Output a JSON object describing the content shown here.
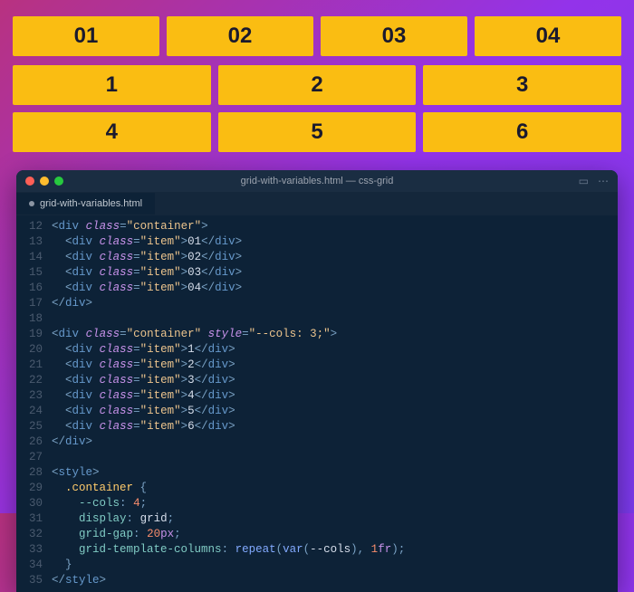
{
  "demo": {
    "row1": [
      "01",
      "02",
      "03",
      "04"
    ],
    "row2": [
      "1",
      "2",
      "3",
      "4",
      "5",
      "6"
    ]
  },
  "window": {
    "title": "grid-with-variables.html — css-grid",
    "tab": "grid-with-variables.html",
    "icon_split": "▭",
    "icon_more": "⋯"
  },
  "code": {
    "lines": [
      {
        "n": "12",
        "seg": [
          {
            "c": "p",
            "t": "<"
          },
          {
            "c": "t",
            "t": "div"
          },
          {
            "c": "p",
            "t": " "
          },
          {
            "c": "a",
            "t": "class"
          },
          {
            "c": "p",
            "t": "="
          },
          {
            "c": "s",
            "t": "\"container\""
          },
          {
            "c": "p",
            "t": ">"
          }
        ]
      },
      {
        "n": "13",
        "seg": [
          {
            "c": "p",
            "t": "  <"
          },
          {
            "c": "t",
            "t": "div"
          },
          {
            "c": "p",
            "t": " "
          },
          {
            "c": "a",
            "t": "class"
          },
          {
            "c": "p",
            "t": "="
          },
          {
            "c": "s",
            "t": "\"item\""
          },
          {
            "c": "p",
            "t": ">"
          },
          {
            "c": "txt",
            "t": "01"
          },
          {
            "c": "p",
            "t": "</"
          },
          {
            "c": "t",
            "t": "div"
          },
          {
            "c": "p",
            "t": ">"
          }
        ]
      },
      {
        "n": "14",
        "seg": [
          {
            "c": "p",
            "t": "  <"
          },
          {
            "c": "t",
            "t": "div"
          },
          {
            "c": "p",
            "t": " "
          },
          {
            "c": "a",
            "t": "class"
          },
          {
            "c": "p",
            "t": "="
          },
          {
            "c": "s",
            "t": "\"item\""
          },
          {
            "c": "p",
            "t": ">"
          },
          {
            "c": "txt",
            "t": "02"
          },
          {
            "c": "p",
            "t": "</"
          },
          {
            "c": "t",
            "t": "div"
          },
          {
            "c": "p",
            "t": ">"
          }
        ]
      },
      {
        "n": "15",
        "seg": [
          {
            "c": "p",
            "t": "  <"
          },
          {
            "c": "t",
            "t": "div"
          },
          {
            "c": "p",
            "t": " "
          },
          {
            "c": "a",
            "t": "class"
          },
          {
            "c": "p",
            "t": "="
          },
          {
            "c": "s",
            "t": "\"item\""
          },
          {
            "c": "p",
            "t": ">"
          },
          {
            "c": "txt",
            "t": "03"
          },
          {
            "c": "p",
            "t": "</"
          },
          {
            "c": "t",
            "t": "div"
          },
          {
            "c": "p",
            "t": ">"
          }
        ]
      },
      {
        "n": "16",
        "seg": [
          {
            "c": "p",
            "t": "  <"
          },
          {
            "c": "t",
            "t": "div"
          },
          {
            "c": "p",
            "t": " "
          },
          {
            "c": "a",
            "t": "class"
          },
          {
            "c": "p",
            "t": "="
          },
          {
            "c": "s",
            "t": "\"item\""
          },
          {
            "c": "p",
            "t": ">"
          },
          {
            "c": "txt",
            "t": "04"
          },
          {
            "c": "p",
            "t": "</"
          },
          {
            "c": "t",
            "t": "div"
          },
          {
            "c": "p",
            "t": ">"
          }
        ]
      },
      {
        "n": "17",
        "seg": [
          {
            "c": "p",
            "t": "</"
          },
          {
            "c": "t",
            "t": "div"
          },
          {
            "c": "p",
            "t": ">"
          }
        ]
      },
      {
        "n": "18",
        "seg": []
      },
      {
        "n": "19",
        "seg": [
          {
            "c": "p",
            "t": "<"
          },
          {
            "c": "t",
            "t": "div"
          },
          {
            "c": "p",
            "t": " "
          },
          {
            "c": "a",
            "t": "class"
          },
          {
            "c": "p",
            "t": "="
          },
          {
            "c": "s",
            "t": "\"container\""
          },
          {
            "c": "p",
            "t": " "
          },
          {
            "c": "a",
            "t": "style"
          },
          {
            "c": "p",
            "t": "="
          },
          {
            "c": "s",
            "t": "\"--cols: 3;\""
          },
          {
            "c": "p",
            "t": ">"
          }
        ]
      },
      {
        "n": "20",
        "seg": [
          {
            "c": "p",
            "t": "  <"
          },
          {
            "c": "t",
            "t": "div"
          },
          {
            "c": "p",
            "t": " "
          },
          {
            "c": "a",
            "t": "class"
          },
          {
            "c": "p",
            "t": "="
          },
          {
            "c": "s",
            "t": "\"item\""
          },
          {
            "c": "p",
            "t": ">"
          },
          {
            "c": "txt",
            "t": "1"
          },
          {
            "c": "p",
            "t": "</"
          },
          {
            "c": "t",
            "t": "div"
          },
          {
            "c": "p",
            "t": ">"
          }
        ]
      },
      {
        "n": "21",
        "seg": [
          {
            "c": "p",
            "t": "  <"
          },
          {
            "c": "t",
            "t": "div"
          },
          {
            "c": "p",
            "t": " "
          },
          {
            "c": "a",
            "t": "class"
          },
          {
            "c": "p",
            "t": "="
          },
          {
            "c": "s",
            "t": "\"item\""
          },
          {
            "c": "p",
            "t": ">"
          },
          {
            "c": "txt",
            "t": "2"
          },
          {
            "c": "p",
            "t": "</"
          },
          {
            "c": "t",
            "t": "div"
          },
          {
            "c": "p",
            "t": ">"
          }
        ]
      },
      {
        "n": "22",
        "seg": [
          {
            "c": "p",
            "t": "  <"
          },
          {
            "c": "t",
            "t": "div"
          },
          {
            "c": "p",
            "t": " "
          },
          {
            "c": "a",
            "t": "class"
          },
          {
            "c": "p",
            "t": "="
          },
          {
            "c": "s",
            "t": "\"item\""
          },
          {
            "c": "p",
            "t": ">"
          },
          {
            "c": "txt",
            "t": "3"
          },
          {
            "c": "p",
            "t": "</"
          },
          {
            "c": "t",
            "t": "div"
          },
          {
            "c": "p",
            "t": ">"
          }
        ]
      },
      {
        "n": "23",
        "seg": [
          {
            "c": "p",
            "t": "  <"
          },
          {
            "c": "t",
            "t": "div"
          },
          {
            "c": "p",
            "t": " "
          },
          {
            "c": "a",
            "t": "class"
          },
          {
            "c": "p",
            "t": "="
          },
          {
            "c": "s",
            "t": "\"item\""
          },
          {
            "c": "p",
            "t": ">"
          },
          {
            "c": "txt",
            "t": "4"
          },
          {
            "c": "p",
            "t": "</"
          },
          {
            "c": "t",
            "t": "div"
          },
          {
            "c": "p",
            "t": ">"
          }
        ]
      },
      {
        "n": "24",
        "seg": [
          {
            "c": "p",
            "t": "  <"
          },
          {
            "c": "t",
            "t": "div"
          },
          {
            "c": "p",
            "t": " "
          },
          {
            "c": "a",
            "t": "class"
          },
          {
            "c": "p",
            "t": "="
          },
          {
            "c": "s",
            "t": "\"item\""
          },
          {
            "c": "p",
            "t": ">"
          },
          {
            "c": "txt",
            "t": "5"
          },
          {
            "c": "p",
            "t": "</"
          },
          {
            "c": "t",
            "t": "div"
          },
          {
            "c": "p",
            "t": ">"
          }
        ]
      },
      {
        "n": "25",
        "seg": [
          {
            "c": "p",
            "t": "  <"
          },
          {
            "c": "t",
            "t": "div"
          },
          {
            "c": "p",
            "t": " "
          },
          {
            "c": "a",
            "t": "class"
          },
          {
            "c": "p",
            "t": "="
          },
          {
            "c": "s",
            "t": "\"item\""
          },
          {
            "c": "p",
            "t": ">"
          },
          {
            "c": "txt",
            "t": "6"
          },
          {
            "c": "p",
            "t": "</"
          },
          {
            "c": "t",
            "t": "div"
          },
          {
            "c": "p",
            "t": ">"
          }
        ]
      },
      {
        "n": "26",
        "seg": [
          {
            "c": "p",
            "t": "</"
          },
          {
            "c": "t",
            "t": "div"
          },
          {
            "c": "p",
            "t": ">"
          }
        ]
      },
      {
        "n": "27",
        "seg": []
      },
      {
        "n": "28",
        "seg": [
          {
            "c": "p",
            "t": "<"
          },
          {
            "c": "t",
            "t": "style"
          },
          {
            "c": "p",
            "t": ">"
          }
        ]
      },
      {
        "n": "29",
        "seg": [
          {
            "c": "txt",
            "t": "  "
          },
          {
            "c": "sel",
            "t": ".container"
          },
          {
            "c": "p",
            "t": " {"
          }
        ]
      },
      {
        "n": "30",
        "seg": [
          {
            "c": "txt",
            "t": "    "
          },
          {
            "c": "prop",
            "t": "--cols"
          },
          {
            "c": "p",
            "t": ": "
          },
          {
            "c": "num",
            "t": "4"
          },
          {
            "c": "p",
            "t": ";"
          }
        ]
      },
      {
        "n": "31",
        "seg": [
          {
            "c": "txt",
            "t": "    "
          },
          {
            "c": "prop",
            "t": "display"
          },
          {
            "c": "p",
            "t": ": "
          },
          {
            "c": "txt",
            "t": "grid"
          },
          {
            "c": "p",
            "t": ";"
          }
        ]
      },
      {
        "n": "32",
        "seg": [
          {
            "c": "txt",
            "t": "    "
          },
          {
            "c": "prop",
            "t": "grid-gap"
          },
          {
            "c": "p",
            "t": ": "
          },
          {
            "c": "num",
            "t": "20"
          },
          {
            "c": "kw",
            "t": "px"
          },
          {
            "c": "p",
            "t": ";"
          }
        ]
      },
      {
        "n": "33",
        "seg": [
          {
            "c": "txt",
            "t": "    "
          },
          {
            "c": "prop",
            "t": "grid-template-columns"
          },
          {
            "c": "p",
            "t": ": "
          },
          {
            "c": "fn",
            "t": "repeat"
          },
          {
            "c": "p",
            "t": "("
          },
          {
            "c": "fn",
            "t": "var"
          },
          {
            "c": "p",
            "t": "("
          },
          {
            "c": "txt",
            "t": "--cols"
          },
          {
            "c": "p",
            "t": "), "
          },
          {
            "c": "num",
            "t": "1"
          },
          {
            "c": "kw",
            "t": "fr"
          },
          {
            "c": "p",
            "t": ");"
          }
        ]
      },
      {
        "n": "34",
        "seg": [
          {
            "c": "txt",
            "t": "  "
          },
          {
            "c": "p",
            "t": "}"
          }
        ]
      },
      {
        "n": "35",
        "seg": [
          {
            "c": "p",
            "t": "</"
          },
          {
            "c": "t",
            "t": "style"
          },
          {
            "c": "p",
            "t": ">"
          }
        ]
      }
    ]
  }
}
